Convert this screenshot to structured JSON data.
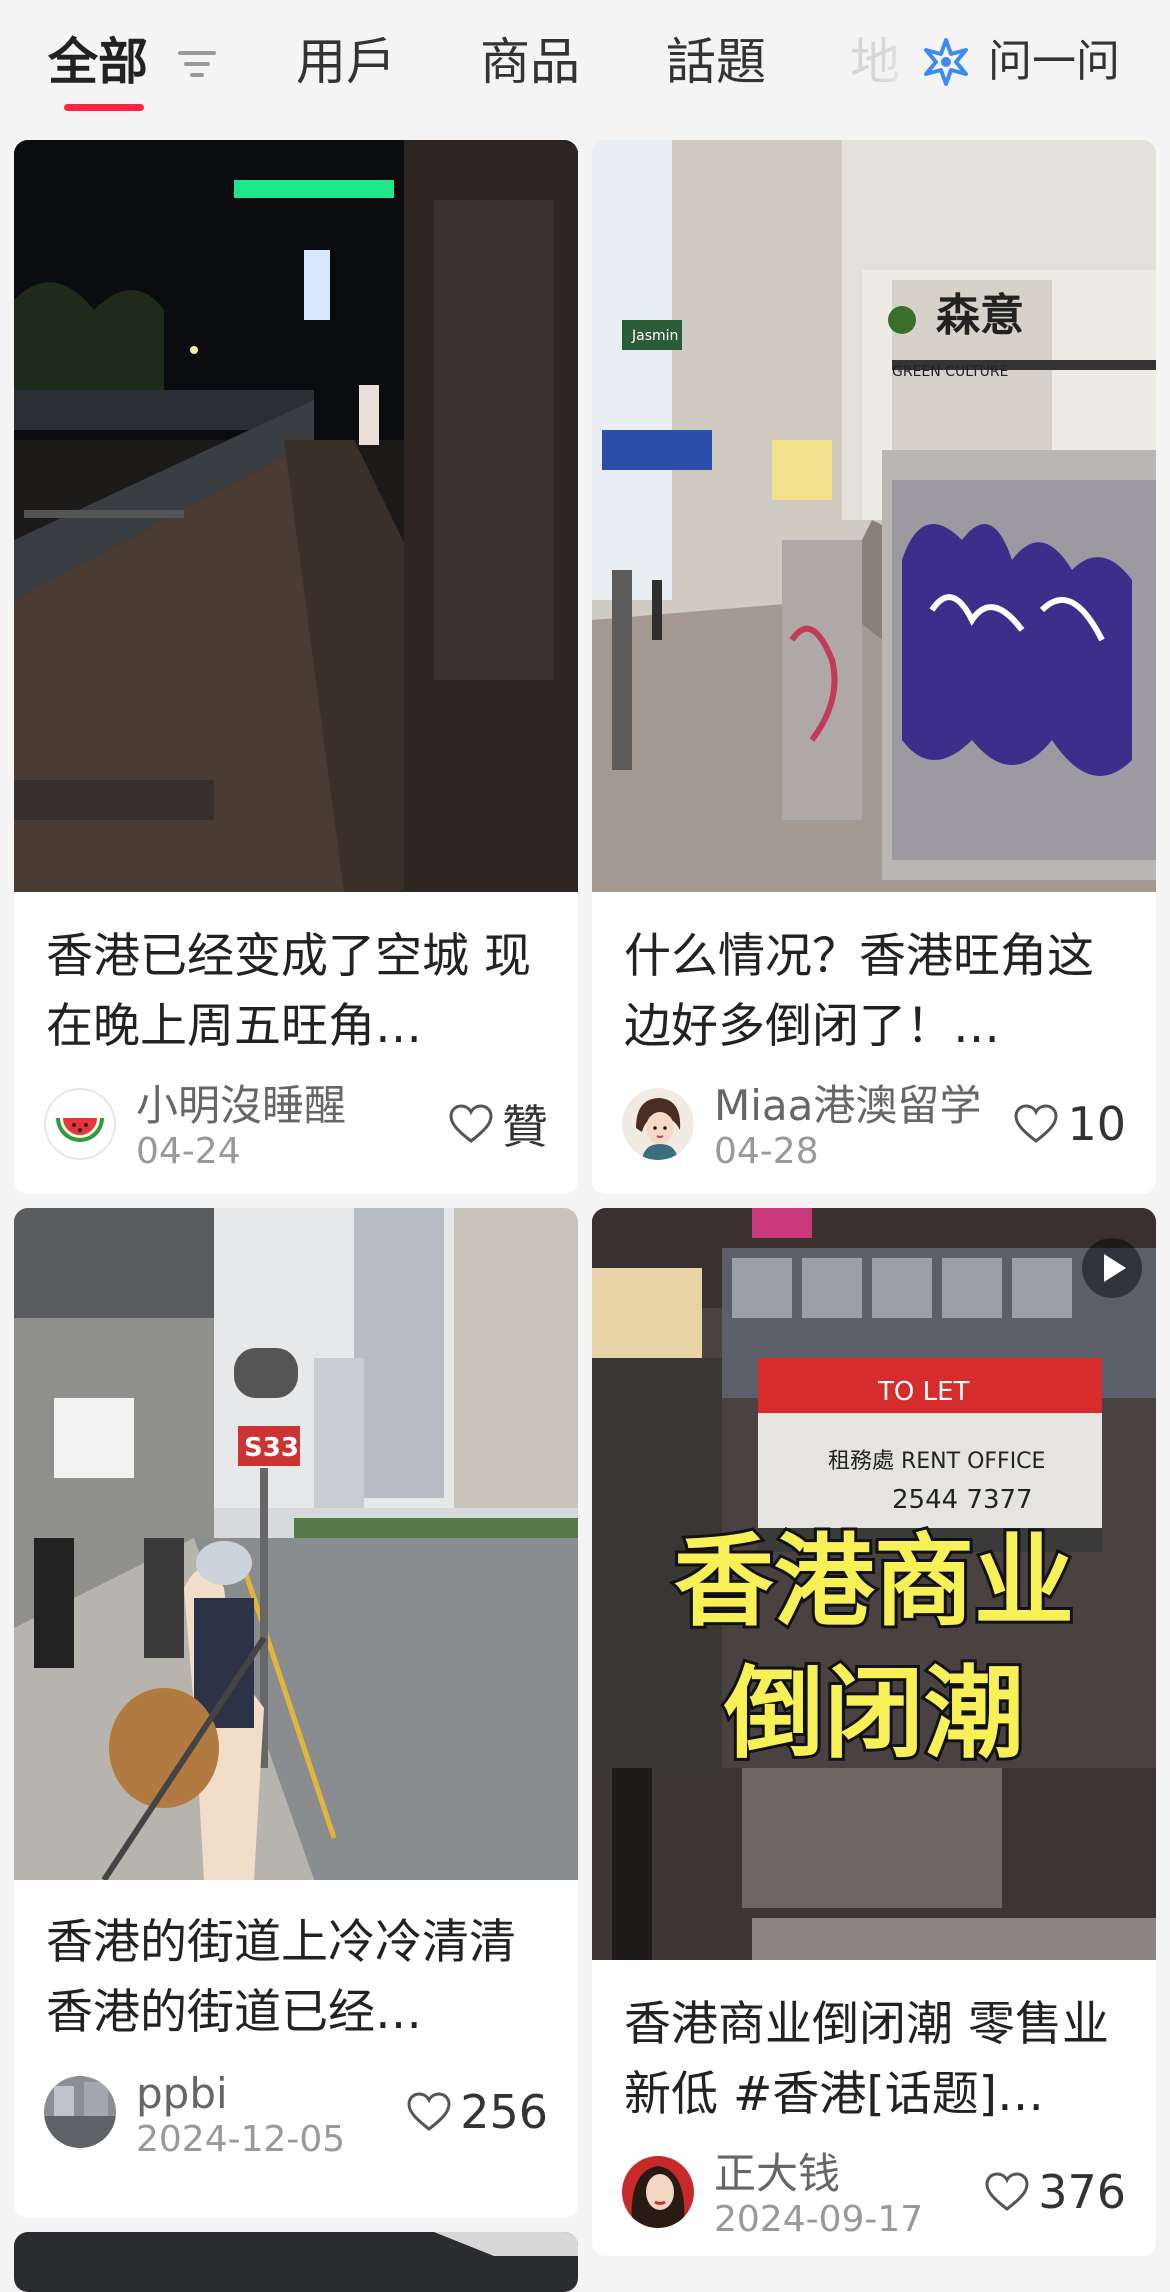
{
  "tabs": {
    "all": "全部",
    "users": "用戶",
    "goods": "商品",
    "topics": "話題",
    "more": "地"
  },
  "ask": {
    "label": "问一问"
  },
  "colors": {
    "accent": "#ff2442",
    "background": "#f4f4f4"
  },
  "posts": [
    {
      "title": "香港已经变成了空城 现在晚上周五旺角…",
      "author": "小明沒睡醒",
      "date": "04-24",
      "likes": "贊",
      "avatar_icon": "watermelon-icon"
    },
    {
      "title": "什么情况？香港旺角这边好多倒闭了！…",
      "author": "Miaa港澳留学",
      "date": "04-28",
      "likes": "10",
      "avatar_icon": "cartoon-girl-avatar"
    },
    {
      "title": "香港的街道上冷冷清清 香港的街道已经…",
      "author": "ppbi",
      "date": "2024-12-05",
      "likes": "256",
      "avatar_icon": "street-photo-avatar"
    },
    {
      "title": "香港商业倒闭潮 零售业新低 #香港[话题]…",
      "author": "正大钱",
      "date": "2024-09-17",
      "likes": "376",
      "avatar_icon": "woman-portrait-avatar",
      "is_video": true,
      "cover_text_line1": "香港商业",
      "cover_text_line2": "倒闭潮"
    }
  ],
  "photo_signs": {
    "card2_store": "森意",
    "card2_store_sub": "GREEN CULTURE",
    "card2_jasmine": "Jasmin",
    "card3_bus": "S33",
    "card4_rent": "租務處 RENT OFFICE",
    "card4_phone": "2544 7377",
    "card4_to_let": "TO LET"
  }
}
